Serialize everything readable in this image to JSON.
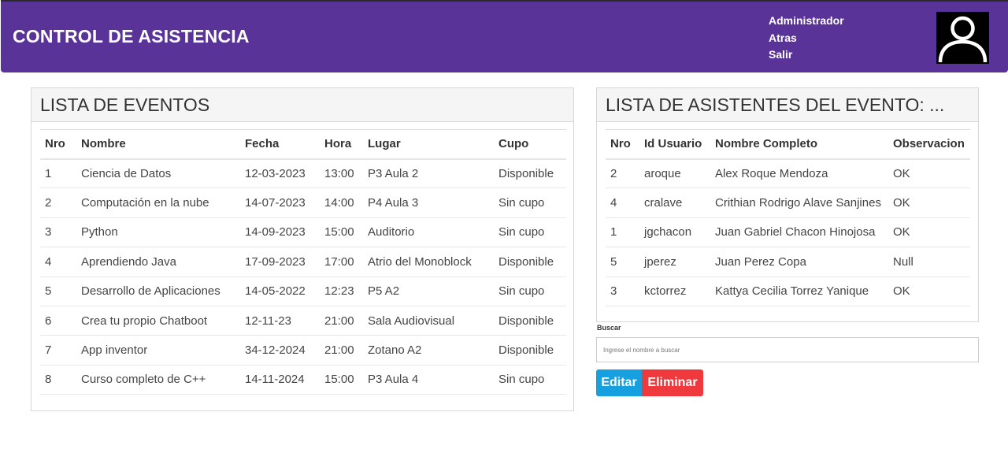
{
  "header": {
    "title": "CONTROL DE ASISTENCIA",
    "menu": [
      "Administrador",
      "Atras",
      "Salir"
    ],
    "avatar_icon": "user-silhouette-icon",
    "bg_color": "#5a3398"
  },
  "events": {
    "title": "LISTA DE EVENTOS",
    "columns": [
      "Nro",
      "Nombre",
      "Fecha",
      "Hora",
      "Lugar",
      "Cupo"
    ],
    "rows": [
      [
        "1",
        "Ciencia de Datos",
        "12-03-2023",
        "13:00",
        "P3 Aula 2",
        "Disponible"
      ],
      [
        "2",
        "Computación en la nube",
        "14-07-2023",
        "14:00",
        "P4 Aula 3",
        "Sin cupo"
      ],
      [
        "3",
        "Python",
        "14-09-2023",
        "15:00",
        "Auditorio",
        "Sin cupo"
      ],
      [
        "4",
        "Aprendiendo Java",
        "17-09-2023",
        "17:00",
        "Atrio del Monoblock",
        "Disponible"
      ],
      [
        "5",
        "Desarrollo de Aplicaciones",
        "14-05-2022",
        "12:23",
        "P5 A2",
        "Sin cupo"
      ],
      [
        "6",
        "Crea tu propio Chatboot",
        "12-11-23",
        "21:00",
        "Sala Audiovisual",
        "Disponible"
      ],
      [
        "7",
        "App inventor",
        "34-12-2024",
        "21:00",
        "Zotano A2",
        "Disponible"
      ],
      [
        "8",
        "Curso completo de C++",
        "14-11-2024",
        "15:00",
        "P3 Aula 4",
        "Sin cupo"
      ]
    ]
  },
  "attendees": {
    "title": "LISTA DE ASISTENTES DEL EVENTO: ...",
    "columns": [
      "Nro",
      "Id Usuario",
      "Nombre Completo",
      "Observacion"
    ],
    "rows": [
      [
        "2",
        "aroque",
        "Alex Roque Mendoza",
        "OK"
      ],
      [
        "4",
        "cralave",
        "Crithian Rodrigo Alave Sanjines",
        "OK"
      ],
      [
        "1",
        "jgchacon",
        "Juan Gabriel Chacon Hinojosa",
        "OK"
      ],
      [
        "5",
        "jperez",
        "Juan Perez Copa",
        "Null"
      ],
      [
        "3",
        "kctorrez",
        "Kattya Cecilia Torrez Yanique",
        "OK"
      ]
    ]
  },
  "search": {
    "label": "Buscar",
    "placeholder": "Ingrese el nombre a buscar",
    "value": ""
  },
  "actions": {
    "edit_label": "Editar",
    "delete_label": "Eliminar",
    "edit_color": "#16a0e0",
    "delete_color": "#f0393c"
  }
}
